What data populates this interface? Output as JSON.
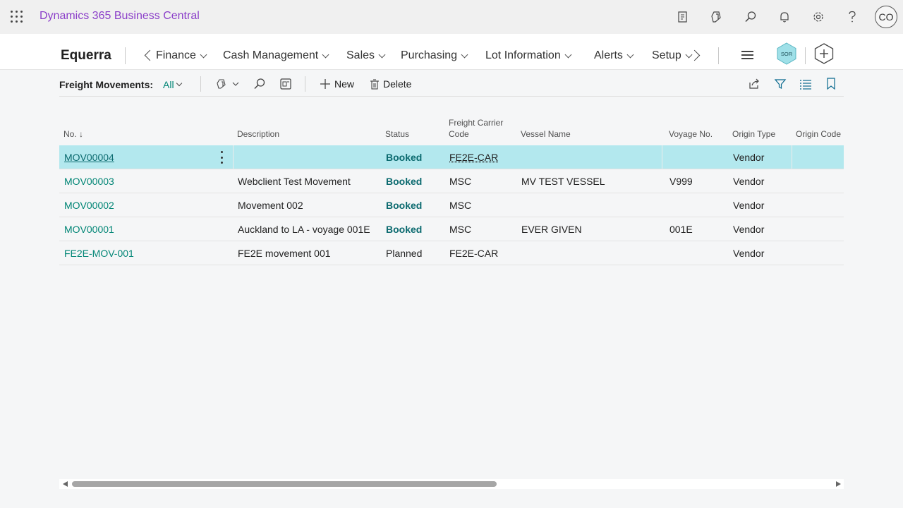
{
  "app": {
    "title": "Dynamics 365 Business Central",
    "user_initials": "CO",
    "top_icons": [
      "report-icon",
      "copilot-icon",
      "search-icon",
      "bell-icon",
      "gear-icon",
      "help-icon"
    ]
  },
  "nav": {
    "company": "Equerra",
    "items": [
      "Finance",
      "Cash Management",
      "Sales",
      "Purchasing",
      "Lot Information",
      "Alerts",
      "Setup"
    ],
    "sor_badge": "SOR"
  },
  "actions": {
    "caption": "Freight Movements:",
    "view": "All",
    "new_label": "New",
    "delete_label": "Delete"
  },
  "table": {
    "columns": [
      "No.",
      "Description",
      "Status",
      "Freight Carrier Code",
      "Vessel Name",
      "Voyage No.",
      "Origin Type",
      "Origin Code"
    ],
    "column_lines": {
      "fc1": "Freight Carrier",
      "fc2": "Code"
    },
    "rows": [
      {
        "no": "MOV00004",
        "description": "",
        "status": "Booked",
        "carrier": "FE2E-CAR",
        "vessel": "",
        "voyage": "",
        "origin_type": "Vendor",
        "origin_code": ""
      },
      {
        "no": "MOV00003",
        "description": "Webclient Test Movement",
        "status": "Booked",
        "carrier": "MSC",
        "vessel": "MV TEST VESSEL",
        "voyage": "V999",
        "origin_type": "Vendor",
        "origin_code": ""
      },
      {
        "no": "MOV00002",
        "description": "Movement 002",
        "status": "Booked",
        "carrier": "MSC",
        "vessel": "",
        "voyage": "",
        "origin_type": "Vendor",
        "origin_code": ""
      },
      {
        "no": "MOV00001",
        "description": "Auckland to LA - voyage 001E",
        "status": "Booked",
        "carrier": "MSC",
        "vessel": "EVER GIVEN",
        "voyage": "001E",
        "origin_type": "Vendor",
        "origin_code": ""
      },
      {
        "no": "FE2E-MOV-001",
        "description": "FE2E movement 001",
        "status": "Planned",
        "carrier": "FE2E-CAR",
        "vessel": "",
        "voyage": "",
        "origin_type": "Vendor",
        "origin_code": ""
      }
    ]
  },
  "colors": {
    "brand": "#8b3fc9",
    "accent": "#008575",
    "selected_row": "#b3e8ee"
  }
}
